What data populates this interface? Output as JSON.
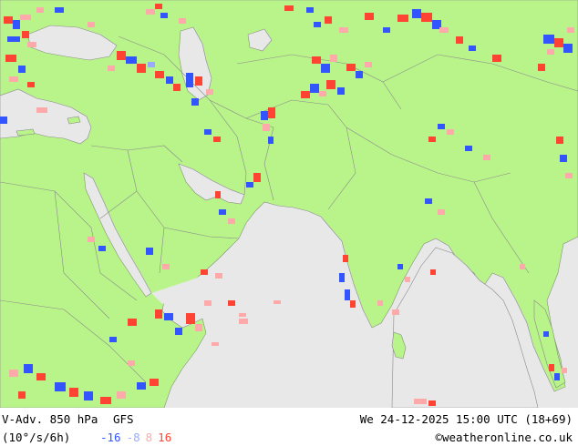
{
  "colors": {
    "land": "#b9f48a",
    "sea": "#e8e8e8",
    "border": "#8a8a8a",
    "neg_strong": "#3355ff",
    "neg_weak": "#99aaff",
    "pos_weak": "#ffaaaa",
    "pos_strong": "#ff4433"
  },
  "footer": {
    "title": "V-Adv. 850 hPa",
    "model": "GFS",
    "valid_time": "We 24-12-2025 15:00 UTC (18+69)",
    "units": "(10°/s/6h)",
    "legend": [
      {
        "value": "-16",
        "color": "#3355ff"
      },
      {
        "value": "-8",
        "color": "#99aaff"
      },
      {
        "value": "8",
        "color": "#ffaaaa"
      },
      {
        "value": "16",
        "color": "#ff4433"
      }
    ],
    "credit": "©weatheronline.co.uk"
  }
}
